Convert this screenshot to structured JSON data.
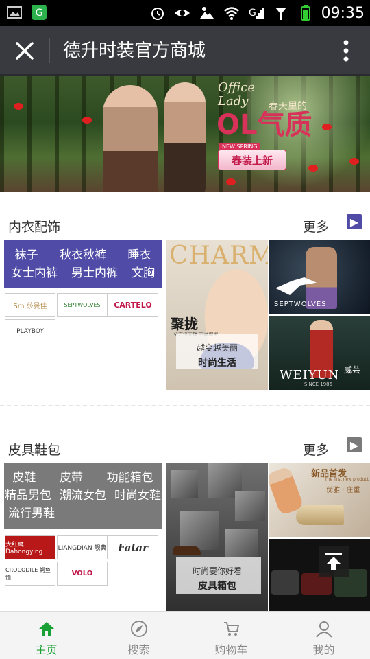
{
  "status_bar": {
    "time": "09:35"
  },
  "title_bar": {
    "title": "德升时装官方商城"
  },
  "banner": {
    "script_line1": "Office",
    "script_line2": "Lady",
    "headline_sub": "春天里的",
    "headline": "OL气质",
    "tag": "NEW SPRING",
    "cta": "春装上新"
  },
  "section1": {
    "title": "内衣配饰",
    "more": "更多",
    "categories": [
      [
        "袜子",
        "秋衣秋裤",
        "睡衣"
      ],
      [
        "女士内裤",
        "男士内裤",
        "文胸"
      ]
    ],
    "brands": [
      "Sm 莎曼佳",
      "SEPTWOLVES",
      "CARTELO",
      "PLAYBOY"
    ],
    "tile_charm": {
      "word": "CHARM",
      "headline": "聚拢",
      "sub": "全方位支撑 丰满胸型",
      "line1": "越变越美丽",
      "line2": "时尚生活"
    },
    "tile_septwolves": {
      "brand": "SEPTWOLVES"
    },
    "tile_weiyun": {
      "brand": "WEIYUN",
      "cn": "威芸",
      "since": "SINCE 1985"
    }
  },
  "section2": {
    "title": "皮具鞋包",
    "more": "更多",
    "categories": [
      [
        "皮鞋",
        "皮带",
        "功能箱包"
      ],
      [
        "精品男包",
        "潮流女包",
        "时尚女鞋"
      ],
      [
        "流行男鞋"
      ]
    ],
    "brands": [
      "大红鹰 Dahongying",
      "LIANGDIAN 靓典",
      "Fatar",
      "CROCODILE 鳄鱼恤",
      "VOLO"
    ],
    "tile_leather": {
      "line1": "时尚要你好看",
      "line2": "皮具箱包"
    },
    "tile_heels": {
      "title": "新品首发",
      "en": "The first new product",
      "sub": "优雅 · 庄重"
    }
  },
  "tabbar": {
    "tabs": [
      {
        "label": "主页",
        "icon": "home-icon",
        "active": true
      },
      {
        "label": "搜索",
        "icon": "compass-icon",
        "active": false
      },
      {
        "label": "购物车",
        "icon": "cart-icon",
        "active": false
      },
      {
        "label": "我的",
        "icon": "user-icon",
        "active": false
      }
    ]
  },
  "colors": {
    "titlebar": "#393a3f",
    "section1_accent": "#4f4ba6",
    "section2_accent": "#7a7a7a",
    "tab_active": "#1aa035",
    "tab_inactive": "#888888"
  }
}
